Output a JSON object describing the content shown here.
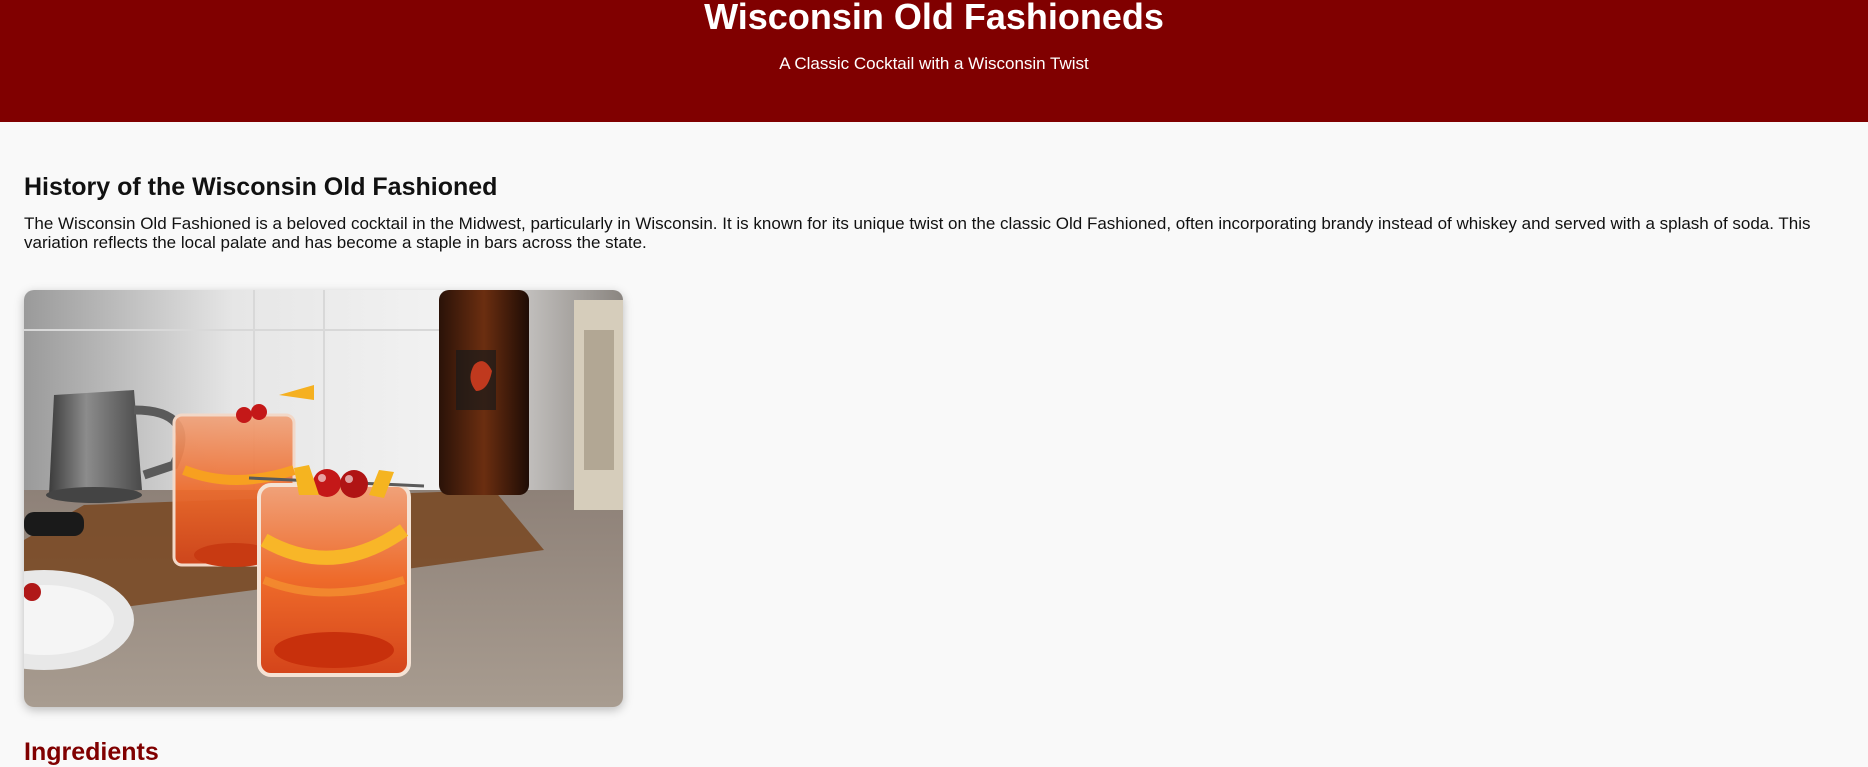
{
  "header": {
    "title": "Wisconsin Old Fashioneds",
    "subtitle": "A Classic Cocktail with a Wisconsin Twist"
  },
  "history": {
    "heading": "History of the Wisconsin Old Fashioned",
    "text": "The Wisconsin Old Fashioned is a beloved cocktail in the Midwest, particularly in Wisconsin. It is known for its unique twist on the classic Old Fashioned, often incorporating brandy instead of whiskey and served with a splash of soda. This variation reflects the local palate and has become a staple in bars across the state."
  },
  "photo": {
    "icon": "cocktail-photo"
  },
  "ingredients": {
    "heading": "Ingredients"
  },
  "colors": {
    "header_bg": "#800000",
    "accent": "#800000",
    "page_bg": "#f9f9f9"
  }
}
